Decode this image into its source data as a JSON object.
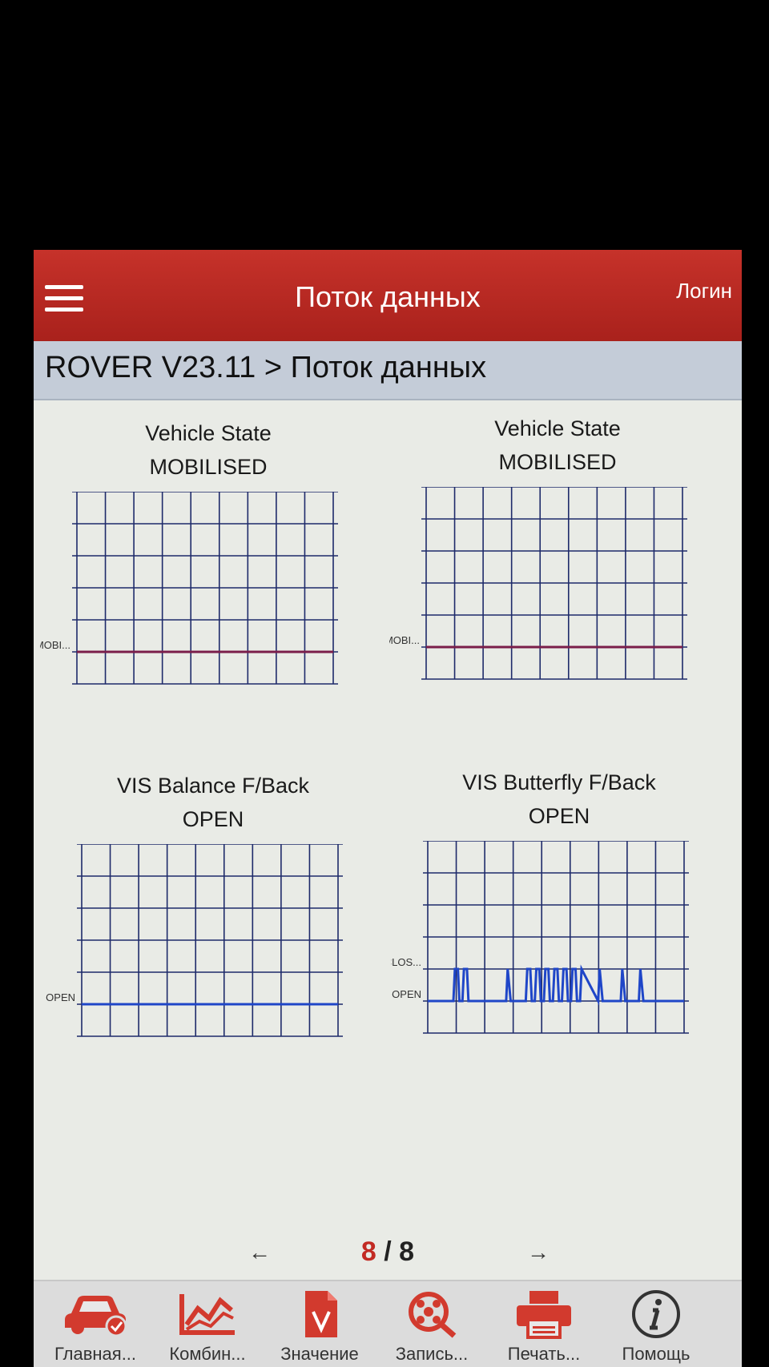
{
  "header": {
    "title": "Поток данных",
    "login_label": "Логин"
  },
  "breadcrumb": {
    "text": "ROVER V23.11 > Поток данных"
  },
  "pager": {
    "current": "8",
    "separator": " / ",
    "total": "8"
  },
  "colors": {
    "accent": "#b8261f",
    "grid": "#1e2a6a",
    "trace": "#1f46c8",
    "trace_alt": "#7a1e4a"
  },
  "chart_data": [
    {
      "type": "line",
      "title": "Vehicle State",
      "value": "MOBILISED",
      "xlim": [
        115,
        285
      ],
      "x_ticks": [
        140,
        180,
        220,
        260
      ],
      "y_ticks": [
        "MOBI..."
      ],
      "series": [
        {
          "x": [
            115,
            285
          ],
          "y": [
            0,
            0
          ]
        }
      ]
    },
    {
      "type": "line",
      "title": "Vehicle State",
      "value": "MOBILISED",
      "xlim": [
        115,
        285
      ],
      "x_ticks": [
        140,
        180,
        220,
        260
      ],
      "y_ticks": [
        "MOBI..."
      ],
      "series": [
        {
          "x": [
            115,
            285
          ],
          "y": [
            0,
            0
          ]
        }
      ]
    },
    {
      "type": "line",
      "title": "VIS Balance F/Back",
      "value": "OPEN",
      "xlim": [
        115,
        285
      ],
      "x_ticks": [
        140,
        180,
        220,
        260
      ],
      "y_ticks": [
        "OPEN"
      ],
      "series": [
        {
          "x": [
            115,
            285
          ],
          "y": [
            0,
            0
          ]
        }
      ]
    },
    {
      "type": "line",
      "title": "VIS Butterfly F/Back",
      "value": "OPEN",
      "xlim": [
        115,
        285
      ],
      "x_ticks": [
        140,
        180,
        220,
        260
      ],
      "y_ticks": [
        "OPEN",
        "CLOS..."
      ],
      "series": [
        {
          "x": [
            115,
            132,
            133,
            135,
            136,
            138,
            139,
            141,
            142,
            144,
            167,
            168,
            170,
            180,
            181,
            183,
            184,
            186,
            187,
            189,
            190,
            192,
            193,
            195,
            196,
            198,
            199,
            201,
            202,
            204,
            205,
            207,
            208,
            210,
            211,
            213,
            214,
            216,
            217,
            228,
            229,
            231,
            243,
            244,
            246,
            255,
            256,
            258,
            285
          ],
          "y": [
            0,
            0,
            1,
            1,
            0,
            0,
            1,
            1,
            0,
            0,
            0,
            1,
            0,
            0,
            1,
            1,
            0,
            0,
            1,
            1,
            0,
            0,
            1,
            1,
            0,
            0,
            1,
            1,
            0,
            0,
            1,
            1,
            0,
            0,
            1,
            1,
            0,
            0,
            1,
            0,
            1,
            0,
            0,
            1,
            0,
            0,
            1,
            0,
            0
          ]
        }
      ]
    }
  ],
  "bottom_nav": [
    {
      "label": "Главная...",
      "icon": "car-icon"
    },
    {
      "label": "Комбин...",
      "icon": "chart-icon"
    },
    {
      "label": "Значение",
      "icon": "document-icon"
    },
    {
      "label": "Запись...",
      "icon": "record-icon"
    },
    {
      "label": "Печать...",
      "icon": "printer-icon"
    },
    {
      "label": "Помощь",
      "icon": "info-icon"
    }
  ]
}
